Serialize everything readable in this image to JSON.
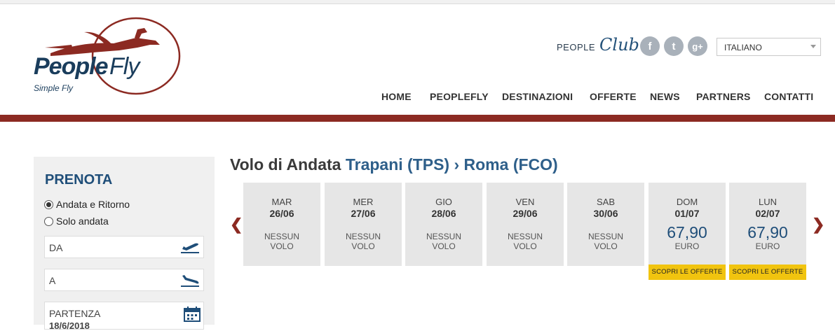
{
  "brand": {
    "name_part1": "People",
    "name_part2": "Fly",
    "tagline": "Simple Fly",
    "accent_color": "#8c2a22",
    "primary_color": "#1a3d5c"
  },
  "header": {
    "people_club_word": "PEOPLE",
    "people_club_script": "Club",
    "social": [
      {
        "icon": "facebook-icon",
        "glyph": "f"
      },
      {
        "icon": "twitter-icon",
        "glyph": "t"
      },
      {
        "icon": "google-plus-icon",
        "glyph": "g+"
      }
    ],
    "language": "ITALIANO"
  },
  "nav": [
    "HOME",
    "PEOPLEFLY",
    "DESTINAZIONI",
    "OFFERTE",
    "NEWS",
    "PARTNERS",
    "CONTATTI"
  ],
  "sidebar": {
    "title": "PRENOTA",
    "options": [
      "Andata e Ritorno",
      "Solo andata"
    ],
    "selected_option": 0,
    "from_placeholder": "DA",
    "to_placeholder": "A",
    "departure_label": "PARTENZA",
    "departure_value": "18/6/2018"
  },
  "flights": {
    "title_prefix": "Volo di Andata",
    "route": "Trapani (TPS) › Roma (FCO)",
    "no_flight_line1": "NESSUN",
    "no_flight_line2": "VOLO",
    "currency": "EURO",
    "offer_label": "SCOPRI LE OFFERTE",
    "days": [
      {
        "day": "MAR",
        "date": "26/06",
        "available": false
      },
      {
        "day": "MER",
        "date": "27/06",
        "available": false
      },
      {
        "day": "GIO",
        "date": "28/06",
        "available": false
      },
      {
        "day": "VEN",
        "date": "29/06",
        "available": false
      },
      {
        "day": "SAB",
        "date": "30/06",
        "available": false
      },
      {
        "day": "DOM",
        "date": "01/07",
        "available": true,
        "price": "67,90"
      },
      {
        "day": "LUN",
        "date": "02/07",
        "available": true,
        "price": "67,90"
      }
    ]
  }
}
